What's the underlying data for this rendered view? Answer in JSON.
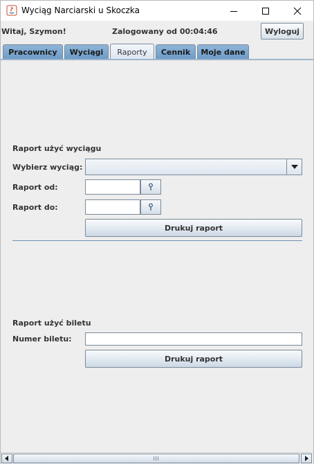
{
  "window": {
    "title": "Wyciąg Narciarski u Skoczka",
    "controls": [
      "minimize-icon",
      "maximize-icon",
      "close-icon"
    ]
  },
  "header": {
    "welcome": "Witaj, Szymon!",
    "logged_in": "Zalogowany od 00:04:46",
    "logout_label": "Wyloguj"
  },
  "tabs": [
    {
      "label": "Pracownicy",
      "active": false
    },
    {
      "label": "Wyciągi",
      "active": false
    },
    {
      "label": "Raporty",
      "active": true
    },
    {
      "label": "Cennik",
      "active": false
    },
    {
      "label": "Moje dane",
      "active": false
    }
  ],
  "lift_report": {
    "section_title": "Raport użyć wyciągu",
    "lift_label": "Wybierz wyciąg:",
    "lift_value": "",
    "from_label": "Raport od:",
    "from_value": "",
    "to_label": "Raport do:",
    "to_value": "",
    "print_label": "Drukuj raport"
  },
  "ticket_report": {
    "section_title": "Raport użyć biletu",
    "ticket_label": "Numer biletu:",
    "ticket_value": "",
    "print_label": "Drukuj raport"
  },
  "colors": {
    "tab_inactive": "#7aa6d1",
    "tab_active": "#e6eef6",
    "separator": "#6f8fb0"
  }
}
